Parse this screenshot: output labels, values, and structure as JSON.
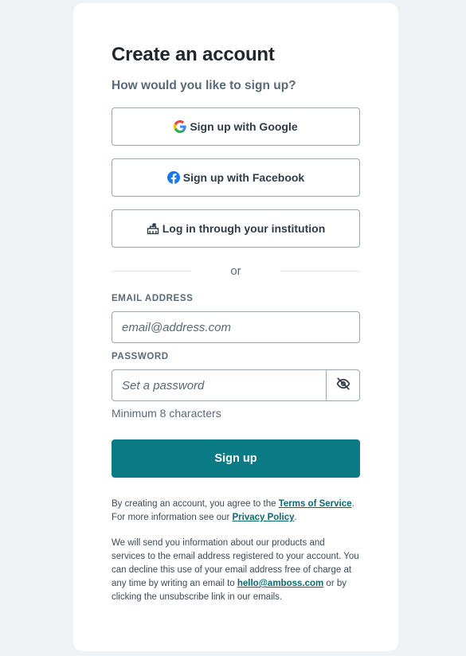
{
  "heading": "Create an account",
  "subheading": "How would you like to sign up?",
  "sso": {
    "google_label": "Sign up with Google",
    "facebook_label": "Sign up with Facebook",
    "institution_label": "Log in through your institution"
  },
  "divider_text": "or",
  "email": {
    "label": "EMAIL ADDRESS",
    "placeholder": "email@address.com",
    "value": ""
  },
  "password": {
    "label": "PASSWORD",
    "placeholder": "Set a password",
    "value": "",
    "hint": "Minimum 8 characters",
    "toggle_icon": "eye-slash-icon"
  },
  "submit_label": "Sign up",
  "legal": {
    "terms_prefix": "By creating an account, you agree to the ",
    "terms_link": "Terms of Service",
    "terms_suffix": ".",
    "privacy_prefix": "For more information see our ",
    "privacy_link": "Privacy Policy",
    "privacy_suffix": ".",
    "marketing_text": "We will send you information about our products and services to the email address registered to your account. You can decline this use of your email address free of charge at any time by writing an email to ",
    "email_link": "hello@amboss.com",
    "marketing_suffix": " or by clicking the unsubscribe link in our emails."
  },
  "colors": {
    "page_background": "#eef2f5",
    "primary": "#0a7b85",
    "google_blue": "#4285F4",
    "google_red": "#EA4335",
    "google_yellow": "#FBBC05",
    "google_green": "#34A853",
    "facebook_blue": "#1877F2"
  }
}
